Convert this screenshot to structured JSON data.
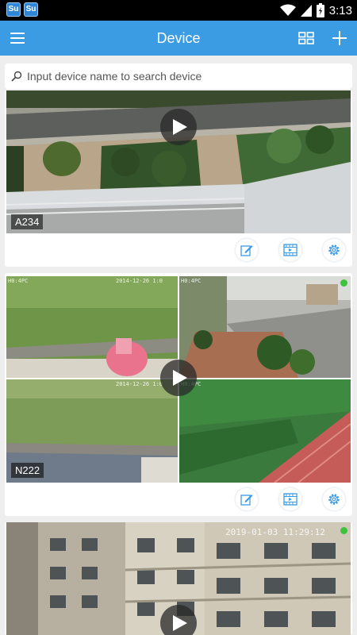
{
  "status_bar": {
    "app_icon_1": "Su",
    "app_icon_2": "Su",
    "time": "3:13"
  },
  "header": {
    "title": "Device",
    "menu_icon": "menu-icon",
    "layout_icon": "grid-layout-icon",
    "add_icon": "plus-icon"
  },
  "search": {
    "placeholder": "Input device name to search device",
    "value": ""
  },
  "devices": [
    {
      "name": "A234",
      "actions": [
        "edit-icon",
        "playback-icon",
        "settings-icon"
      ]
    },
    {
      "name": "N222",
      "actions": [
        "edit-icon",
        "playback-icon",
        "settings-icon"
      ],
      "osd": {
        "ch1_label": "H0:4PC",
        "ch1_time": "2014-12-26 1:0",
        "ch2_label": "H0:4PC",
        "ch3_time": "2014-12-26 1:0",
        "ch4_label": "H0:4PC"
      }
    },
    {
      "name": "",
      "osd_time": "2019-01-03 11:29:12"
    }
  ],
  "colors": {
    "header": "#3b9be3",
    "accent": "#3b9be3",
    "online_dot": "#3cc23c"
  }
}
